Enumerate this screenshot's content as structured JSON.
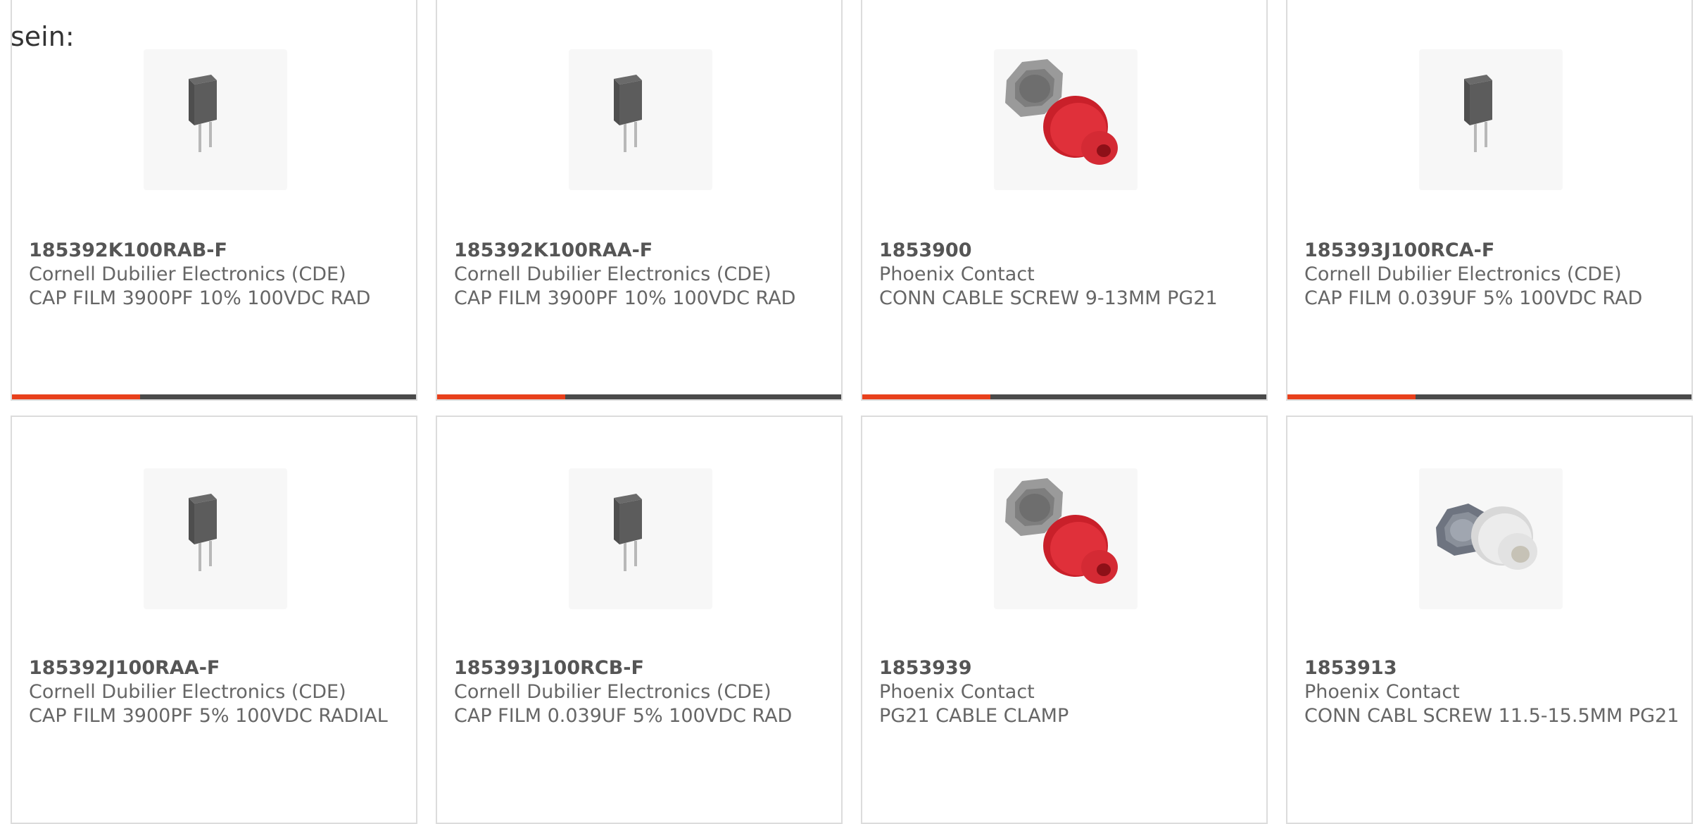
{
  "intro_text": "sein:",
  "colors": {
    "accent": "#e8401c",
    "bar_dark": "#4a4a4a",
    "text": "#666666"
  },
  "products": [
    {
      "part_number": "185392K100RAB-F",
      "manufacturer": "Cornell Dubilier Electronics (CDE)",
      "description": "CAP FILM 3900PF 10% 100VDC RAD",
      "image": "film-capacitor-icon"
    },
    {
      "part_number": "185392K100RAA-F",
      "manufacturer": "Cornell Dubilier Electronics (CDE)",
      "description": "CAP FILM 3900PF 10% 100VDC RAD",
      "image": "film-capacitor-icon"
    },
    {
      "part_number": "1853900",
      "manufacturer": "Phoenix Contact",
      "description": "CONN CABLE SCREW 9-13MM PG21",
      "image": "cable-gland-red-icon"
    },
    {
      "part_number": "185393J100RCA-F",
      "manufacturer": "Cornell Dubilier Electronics (CDE)",
      "description": "CAP FILM 0.039UF 5% 100VDC RAD",
      "image": "film-capacitor-icon"
    },
    {
      "part_number": "185392J100RAA-F",
      "manufacturer": "Cornell Dubilier Electronics (CDE)",
      "description": "CAP FILM 3900PF 5% 100VDC RADIAL",
      "image": "film-capacitor-icon"
    },
    {
      "part_number": "185393J100RCB-F",
      "manufacturer": "Cornell Dubilier Electronics (CDE)",
      "description": "CAP FILM 0.039UF 5% 100VDC RAD",
      "image": "film-capacitor-icon"
    },
    {
      "part_number": "1853939",
      "manufacturer": "Phoenix Contact",
      "description": "PG21 CABLE CLAMP",
      "image": "cable-gland-red-icon"
    },
    {
      "part_number": "1853913",
      "manufacturer": "Phoenix Contact",
      "description": "CONN CABL SCREW 11.5-15.5MM PG21",
      "image": "cable-gland-white-icon"
    }
  ]
}
